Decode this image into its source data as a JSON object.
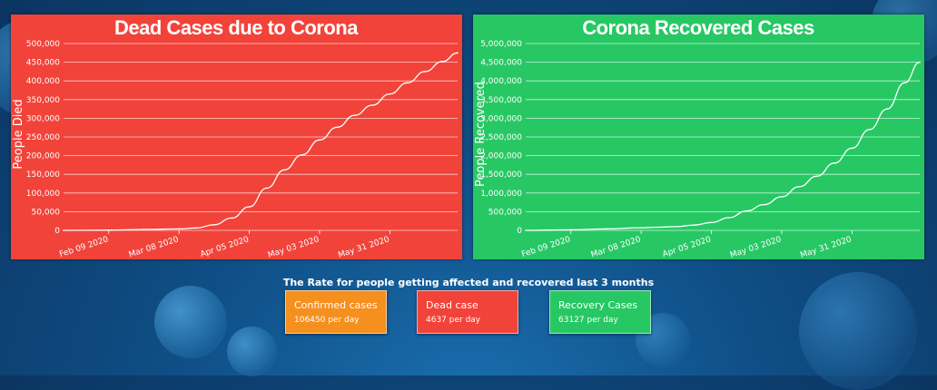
{
  "colors": {
    "dead_panel": "#f2433a",
    "recovered_panel": "#27c864",
    "confirmed_card": "#f5901e",
    "line": "#ffffff",
    "background": "#0f4e85"
  },
  "chart_data": [
    {
      "type": "line",
      "title": "Dead Cases due to Corona",
      "xlabel": "",
      "ylabel": "People Died",
      "ylim": [
        0,
        500000
      ],
      "y_ticks": [
        0,
        50000,
        100000,
        150000,
        200000,
        250000,
        300000,
        350000,
        400000,
        450000,
        500000
      ],
      "y_tick_labels": [
        "0",
        "50,000",
        "100,000",
        "150,000",
        "200,000",
        "250,000",
        "300,000",
        "350,000",
        "400,000",
        "450,000",
        "500,000"
      ],
      "x_tick_labels": [
        "Feb 09 2020",
        "Mar 08 2020",
        "Apr 05 2020",
        "May 03 2020",
        "May 31 2020"
      ],
      "xlim": [
        "2020-01-22",
        "2020-06-27"
      ],
      "grid": true,
      "series": [
        {
          "x": [
            "2020-01-22",
            "2020-02-09",
            "2020-02-23",
            "2020-03-08",
            "2020-03-15",
            "2020-03-22",
            "2020-03-29",
            "2020-04-05",
            "2020-04-12",
            "2020-04-19",
            "2020-04-26",
            "2020-05-03",
            "2020-05-10",
            "2020-05-17",
            "2020-05-24",
            "2020-05-31",
            "2020-06-07",
            "2020-06-14",
            "2020-06-21",
            "2020-06-27"
          ],
          "y": [
            0,
            800,
            2500,
            3800,
            6500,
            15000,
            33000,
            63000,
            113000,
            162000,
            202000,
            242000,
            276000,
            308000,
            335000,
            365000,
            395000,
            425000,
            452000,
            475000
          ]
        }
      ]
    },
    {
      "type": "line",
      "title": "Corona Recovered Cases",
      "xlabel": "",
      "ylabel": "People Recovered",
      "ylim": [
        0,
        5000000
      ],
      "y_ticks": [
        0,
        500000,
        1000000,
        1500000,
        2000000,
        2500000,
        3000000,
        3500000,
        4000000,
        4500000,
        5000000
      ],
      "y_tick_labels": [
        "0",
        "500,000",
        "1,000,000",
        "1,500,000",
        "2,000,000",
        "2,500,000",
        "3,000,000",
        "3,500,000",
        "4,000,000",
        "4,500,000",
        "5,000,000"
      ],
      "x_tick_labels": [
        "Feb 09 2020",
        "Mar 08 2020",
        "Apr 05 2020",
        "May 03 2020",
        "May 31 2020"
      ],
      "xlim": [
        "2020-01-22",
        "2020-06-27"
      ],
      "grid": true,
      "series": [
        {
          "x": [
            "2020-01-22",
            "2020-02-09",
            "2020-02-23",
            "2020-03-08",
            "2020-03-15",
            "2020-03-22",
            "2020-03-29",
            "2020-04-05",
            "2020-04-12",
            "2020-04-19",
            "2020-04-26",
            "2020-05-03",
            "2020-05-10",
            "2020-05-17",
            "2020-05-24",
            "2020-05-31",
            "2020-06-07",
            "2020-06-14",
            "2020-06-21",
            "2020-06-27"
          ],
          "y": [
            0,
            15000,
            40000,
            70000,
            85000,
            100000,
            140000,
            210000,
            340000,
            520000,
            690000,
            900000,
            1170000,
            1450000,
            1800000,
            2200000,
            2700000,
            3250000,
            3950000,
            4500000
          ]
        }
      ]
    }
  ],
  "rate": {
    "title": "The Rate for people getting affected and recovered last 3 months",
    "cards": [
      {
        "label": "Confirmed cases",
        "value": "106450 per day"
      },
      {
        "label": "Dead case",
        "value": "4637 per day"
      },
      {
        "label": "Recovery Cases",
        "value": "63127 per day"
      }
    ]
  }
}
